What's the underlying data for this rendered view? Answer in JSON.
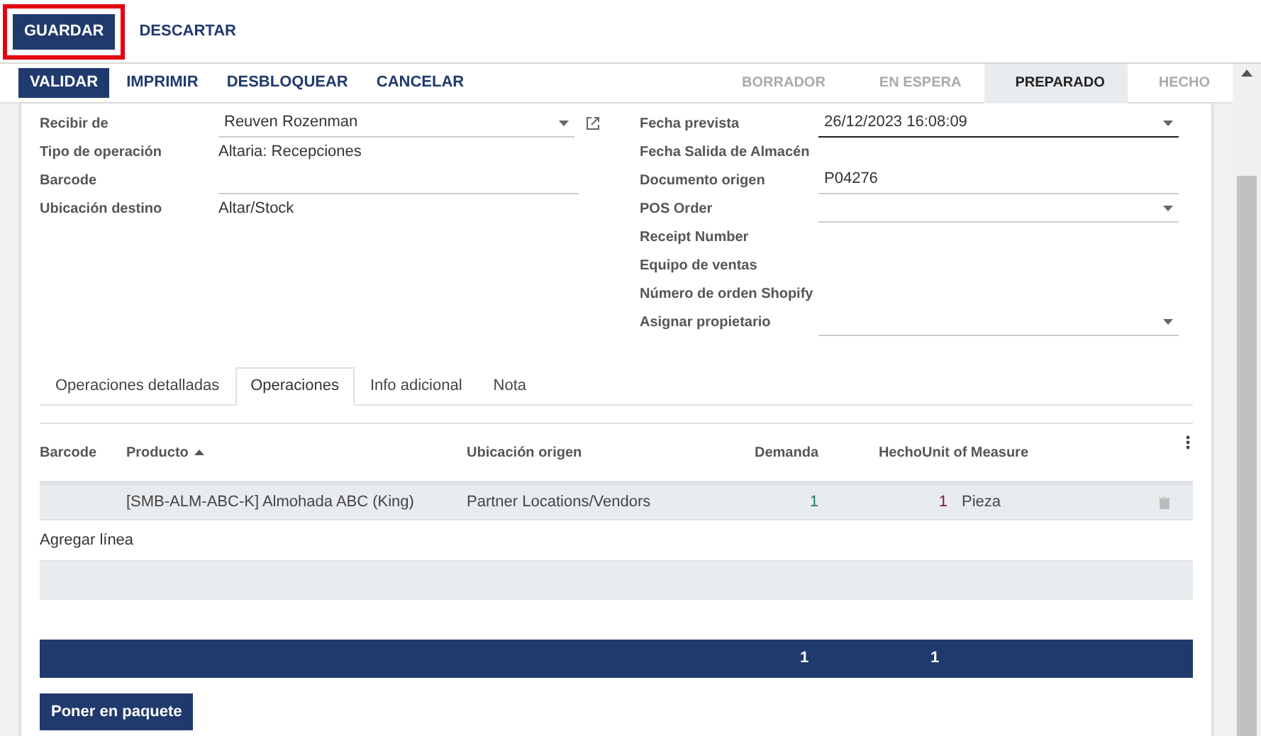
{
  "top_buttons": [
    {
      "label": "GUARDAR",
      "kind": "primary",
      "highlighted": true
    },
    {
      "label": "DESCARTAR",
      "kind": "link",
      "highlighted": false
    }
  ],
  "action_buttons": [
    {
      "label": "VALIDAR",
      "kind": "primary"
    },
    {
      "label": "IMPRIMIR",
      "kind": "secondary"
    },
    {
      "label": "DESBLOQUEAR",
      "kind": "secondary"
    },
    {
      "label": "CANCELAR",
      "kind": "secondary"
    }
  ],
  "status_steps": [
    {
      "label": "BORRADOR",
      "selected": false
    },
    {
      "label": "EN ESPERA",
      "selected": false
    },
    {
      "label": "PREPARADO",
      "selected": true
    },
    {
      "label": "HECHO",
      "selected": false
    }
  ],
  "left_fields": [
    {
      "label": "Recibir de",
      "value": "Reuven Rozenman",
      "kind": "select",
      "external_link": true
    },
    {
      "label": "Tipo de operación",
      "value": "Altaria: Recepciones",
      "kind": "plain",
      "external_link": false
    },
    {
      "label": "Barcode",
      "kind": "input",
      "external_link": false
    },
    {
      "label": "Ubicación destino",
      "value": "Altar/Stock",
      "kind": "plain",
      "external_link": false
    }
  ],
  "right_fields": [
    {
      "label": "Fecha prevista",
      "value": "26/12/2023 16:08:09",
      "kind": "select",
      "focused": true
    },
    {
      "label": "Fecha Salida de Almacén",
      "kind": "plain",
      "focused": false
    },
    {
      "label": "Documento origen",
      "value": "P04276",
      "kind": "input",
      "focused": false
    },
    {
      "label": "POS Order",
      "kind": "select",
      "focused": false
    },
    {
      "label": "Receipt Number",
      "kind": "plain",
      "focused": false
    },
    {
      "label": "Equipo de ventas",
      "kind": "plain",
      "focused": false
    },
    {
      "label": "Número de orden Shopify",
      "kind": "plain",
      "focused": false
    },
    {
      "label": "Asignar propietario",
      "kind": "select",
      "focused": false
    }
  ],
  "tabs": [
    {
      "label": "Operaciones detalladas",
      "selected": false
    },
    {
      "label": "Operaciones",
      "selected": true
    },
    {
      "label": "Info adicional",
      "selected": false
    },
    {
      "label": "Nota",
      "selected": false
    }
  ],
  "table": {
    "columns": [
      {
        "label": "Barcode",
        "sorted": false
      },
      {
        "label": "Producto",
        "sorted": true
      },
      {
        "label": "Ubicación origen",
        "sorted": false
      },
      {
        "label": "Demanda",
        "sorted": false
      },
      {
        "label": "Hecho",
        "sorted": false
      },
      {
        "label": "Unit of Measure",
        "sorted": false
      }
    ],
    "rows": [
      {
        "product": "[SMB-ALM-ABC-K] Almohada ABC (King)",
        "source": "Partner Locations/Vendors",
        "demand": "1",
        "done": "1",
        "uom": "Pieza"
      }
    ],
    "add_line": "Agregar línea",
    "totals": {
      "demand": "1",
      "done": "1"
    }
  },
  "footer_button": "Poner en paquete"
}
